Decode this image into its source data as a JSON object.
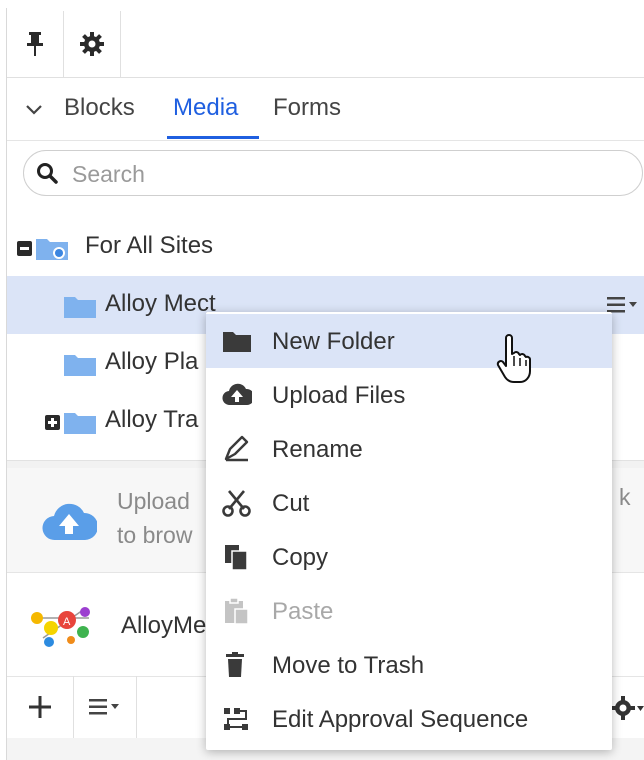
{
  "toolbar": {
    "pin_icon": "pin-icon",
    "settings_icon": "gear-icon"
  },
  "tabs": [
    {
      "label": "Blocks"
    },
    {
      "label": "Media",
      "active": true
    },
    {
      "label": "Forms"
    }
  ],
  "search": {
    "placeholder": "Search",
    "value": ""
  },
  "tree": {
    "root": {
      "label": "For All Sites"
    },
    "items": [
      {
        "label": "Alloy Mect",
        "selected": true
      },
      {
        "label": "Alloy Pla"
      },
      {
        "label": "Alloy Tra",
        "collapsed": true
      }
    ]
  },
  "upload": {
    "line1": "Upload",
    "line2": "to brow",
    "trailing": "k"
  },
  "media": {
    "name": "AlloyMe"
  },
  "context_menu": {
    "items": [
      {
        "label": "New Folder",
        "icon": "folder-icon",
        "hover": true
      },
      {
        "label": "Upload Files",
        "icon": "cloud-upload-icon"
      },
      {
        "label": "Rename",
        "icon": "rename-icon"
      },
      {
        "label": "Cut",
        "icon": "scissors-icon"
      },
      {
        "label": "Copy",
        "icon": "copy-icon"
      },
      {
        "label": "Paste",
        "icon": "paste-icon",
        "disabled": true
      },
      {
        "label": "Move to Trash",
        "icon": "trash-icon"
      },
      {
        "label": "Edit Approval Sequence",
        "icon": "approval-sequence-icon"
      }
    ]
  },
  "colors": {
    "accent": "#1f5fe0",
    "folder": "#7fb2ee",
    "selection": "#dbe4f7"
  }
}
